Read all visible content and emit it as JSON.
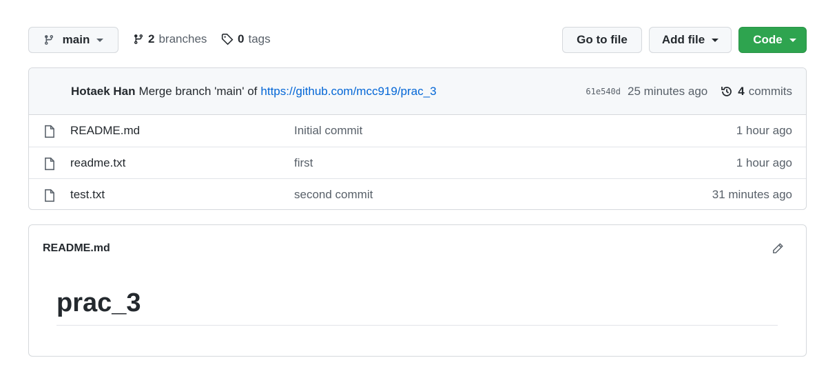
{
  "toolbar": {
    "branch": "main",
    "branches_count": "2",
    "branches_label": "branches",
    "tags_count": "0",
    "tags_label": "tags",
    "go_to_file": "Go to file",
    "add_file": "Add file",
    "code": "Code"
  },
  "commit": {
    "author": "Hotaek Han",
    "message": "Merge branch 'main' of",
    "link": "https://github.com/mcc919/prac_3",
    "sha": "61e540d",
    "time": "25 minutes ago",
    "commits_count": "4",
    "commits_label": "commits"
  },
  "files": [
    {
      "name": "README.md",
      "message": "Initial commit",
      "time": "1 hour ago"
    },
    {
      "name": "readme.txt",
      "message": "first",
      "time": "1 hour ago"
    },
    {
      "name": "test.txt",
      "message": "second commit",
      "time": "31 minutes ago"
    }
  ],
  "readme": {
    "filename": "README.md",
    "heading": "prac_3"
  },
  "colors": {
    "primary": "#2ea44f",
    "link": "#0366d6"
  }
}
